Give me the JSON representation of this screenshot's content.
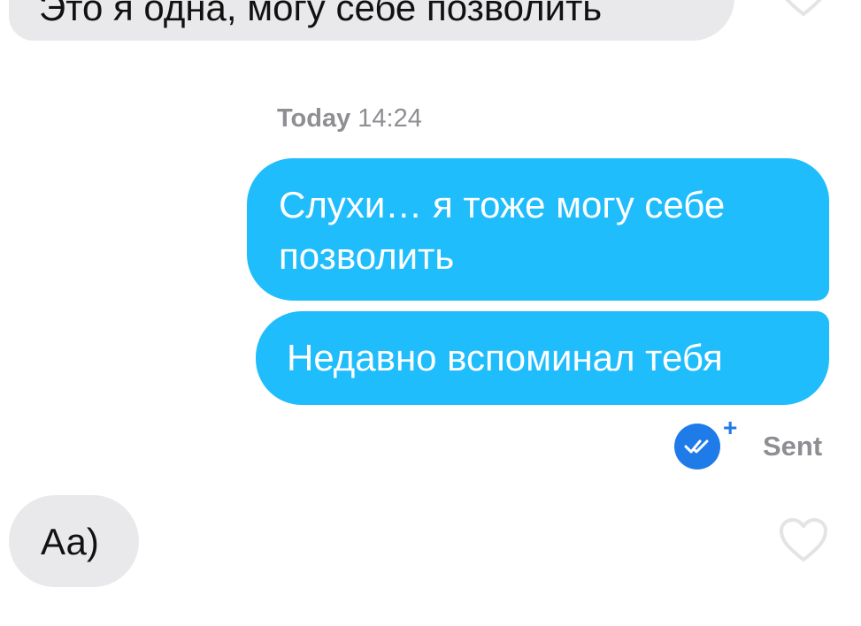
{
  "messages": {
    "top_incoming": "Это я одна, могу себе позволить",
    "timestamp": {
      "day": "Today",
      "time": "14:24"
    },
    "outgoing_1": "Слухи… я тоже могу себе позволить",
    "outgoing_2": "Недавно вспоминал тебя",
    "status": {
      "plus": "+",
      "sent_label": "Sent",
      "read_icon": "double-check-icon"
    },
    "incoming_reply": "Аа)"
  },
  "colors": {
    "outgoing_bubble": "#1fbdfc",
    "incoming_bubble": "#e9e9eb",
    "read_badge": "#1f7be8",
    "muted_text": "#8e8e93"
  }
}
